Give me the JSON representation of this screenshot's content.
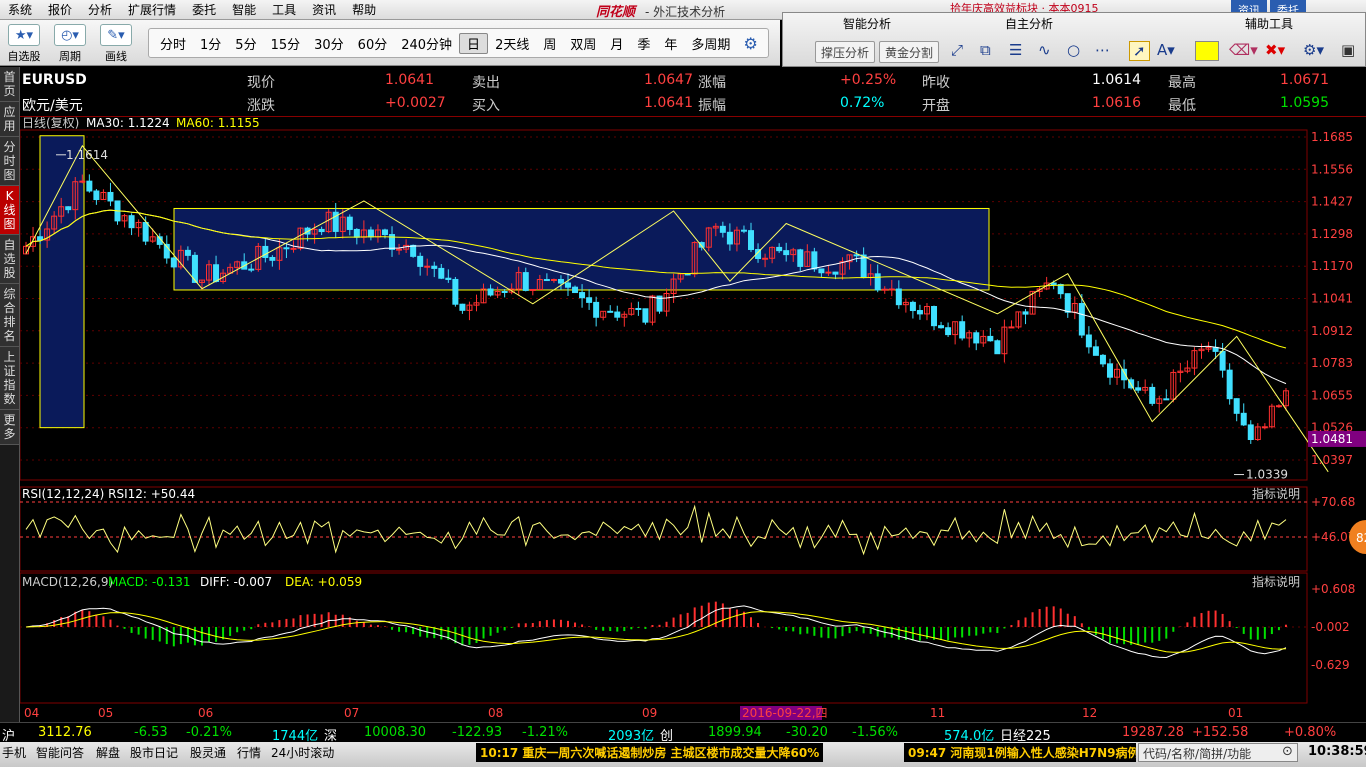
{
  "menu": [
    "系统",
    "报价",
    "分析",
    "扩展行情",
    "委托",
    "智能",
    "工具",
    "资讯",
    "帮助"
  ],
  "brand": "同花顺",
  "window_title": "- 外汇技术分析",
  "toolbar": {
    "buttons": [
      {
        "label": "自选股",
        "icon": "star-icon"
      },
      {
        "label": "周期",
        "icon": "clock-icon"
      },
      {
        "label": "画线",
        "icon": "pencil-icon"
      }
    ],
    "periods": [
      "分时",
      "1分",
      "5分",
      "15分",
      "30分",
      "60分",
      "240分钟",
      "日",
      "2天线",
      "周",
      "双周",
      "月",
      "季",
      "年",
      "多周期"
    ],
    "selected_period": "日"
  },
  "right_panel": {
    "heads": [
      "智能分析",
      "自主分析",
      "辅助工具"
    ],
    "buttons": [
      "撑压分析",
      "黄金分割"
    ]
  },
  "top_right": {
    "promo": "拾年庆高效益标块 · 本本0915",
    "tabs": [
      "资讯",
      "委托"
    ]
  },
  "left_tabs": [
    "首页",
    "应用",
    "分时图",
    "K线图",
    "自选股",
    "综合排名",
    "上证指数",
    "更多"
  ],
  "quote": {
    "symbol": "EURUSD",
    "name": "欧元/美元",
    "rows": [
      [
        {
          "l": "现价",
          "v": "1.0641"
        },
        {
          "l": "卖出",
          "v": "1.0647"
        },
        {
          "l": "涨幅",
          "v": "+0.25%"
        },
        {
          "l": "昨收",
          "v": "1.0614"
        },
        {
          "l": "最高",
          "v": "1.0671"
        }
      ],
      [
        {
          "l": "涨跌",
          "v": "+0.0027"
        },
        {
          "l": "买入",
          "v": "1.0641"
        },
        {
          "l": "振幅",
          "v": "0.72%"
        },
        {
          "l": "开盘",
          "v": "1.0616"
        },
        {
          "l": "最低",
          "v": "1.0595"
        }
      ]
    ]
  },
  "indicators": {
    "main": "日线(复权)",
    "ma30": "MA30: 1.1224",
    "ma60": "MA60: 1.1155",
    "rsi": "RSI(12,12,24) RSI12: +50.44",
    "macd_name": "MACD(12,26,9)",
    "macd": "MACD: -0.131",
    "diff": "DIFF: -0.007",
    "dea": "DEA: +0.059",
    "explain": "指标说明"
  },
  "chart_data": {
    "type": "candlestick",
    "y_ticks": [
      "1.1685",
      "1.1556",
      "1.1427",
      "1.1298",
      "1.1170",
      "1.1041",
      "1.0912",
      "1.0783",
      "1.0655",
      "1.0526",
      "1.0397"
    ],
    "current_price_label": "1.0481",
    "high_mark": "1.1614",
    "low_mark": "1.0339",
    "rsi_ticks": [
      "+70.68",
      "+46.07"
    ],
    "macd_ticks": [
      "+0.608",
      "-0.002",
      "-0.629"
    ],
    "x_labels": [
      "04",
      "05",
      "06",
      "07",
      "08",
      "09",
      "2016-09-22,四",
      "11",
      "12",
      "01"
    ],
    "highlight_date": "2016-09-22,四",
    "badge": "82"
  },
  "status": {
    "sh": {
      "label": "沪",
      "v": "3112.76",
      "c": "-6.53",
      "p": "-0.21%",
      "amt": "1744亿"
    },
    "sz": {
      "label": "深",
      "v": "10008.30",
      "c": "-122.93",
      "p": "-1.21%",
      "amt": "2093亿"
    },
    "cy": {
      "label": "创",
      "v": "1899.94",
      "c": "-30.20",
      "p": "-1.56%",
      "amt": "574.0亿"
    },
    "rj": {
      "label": "日经225",
      "v": "19287.28",
      "c": "+152.58",
      "p": "+0.80%"
    }
  },
  "bottom": {
    "items": [
      "手机",
      "智能问答",
      "解盘",
      "股市日记",
      "股灵通",
      "行情",
      "24小时滚动"
    ],
    "news1": "10:17 重庆一周六次喊话遏制炒房 主城区楼市成交量大降60%",
    "news2": "09:47 河南现1例输入性人感染H7N9病例",
    "search_placeholder": "代码/名称/简拼/功能",
    "clock": "10:38:59"
  }
}
